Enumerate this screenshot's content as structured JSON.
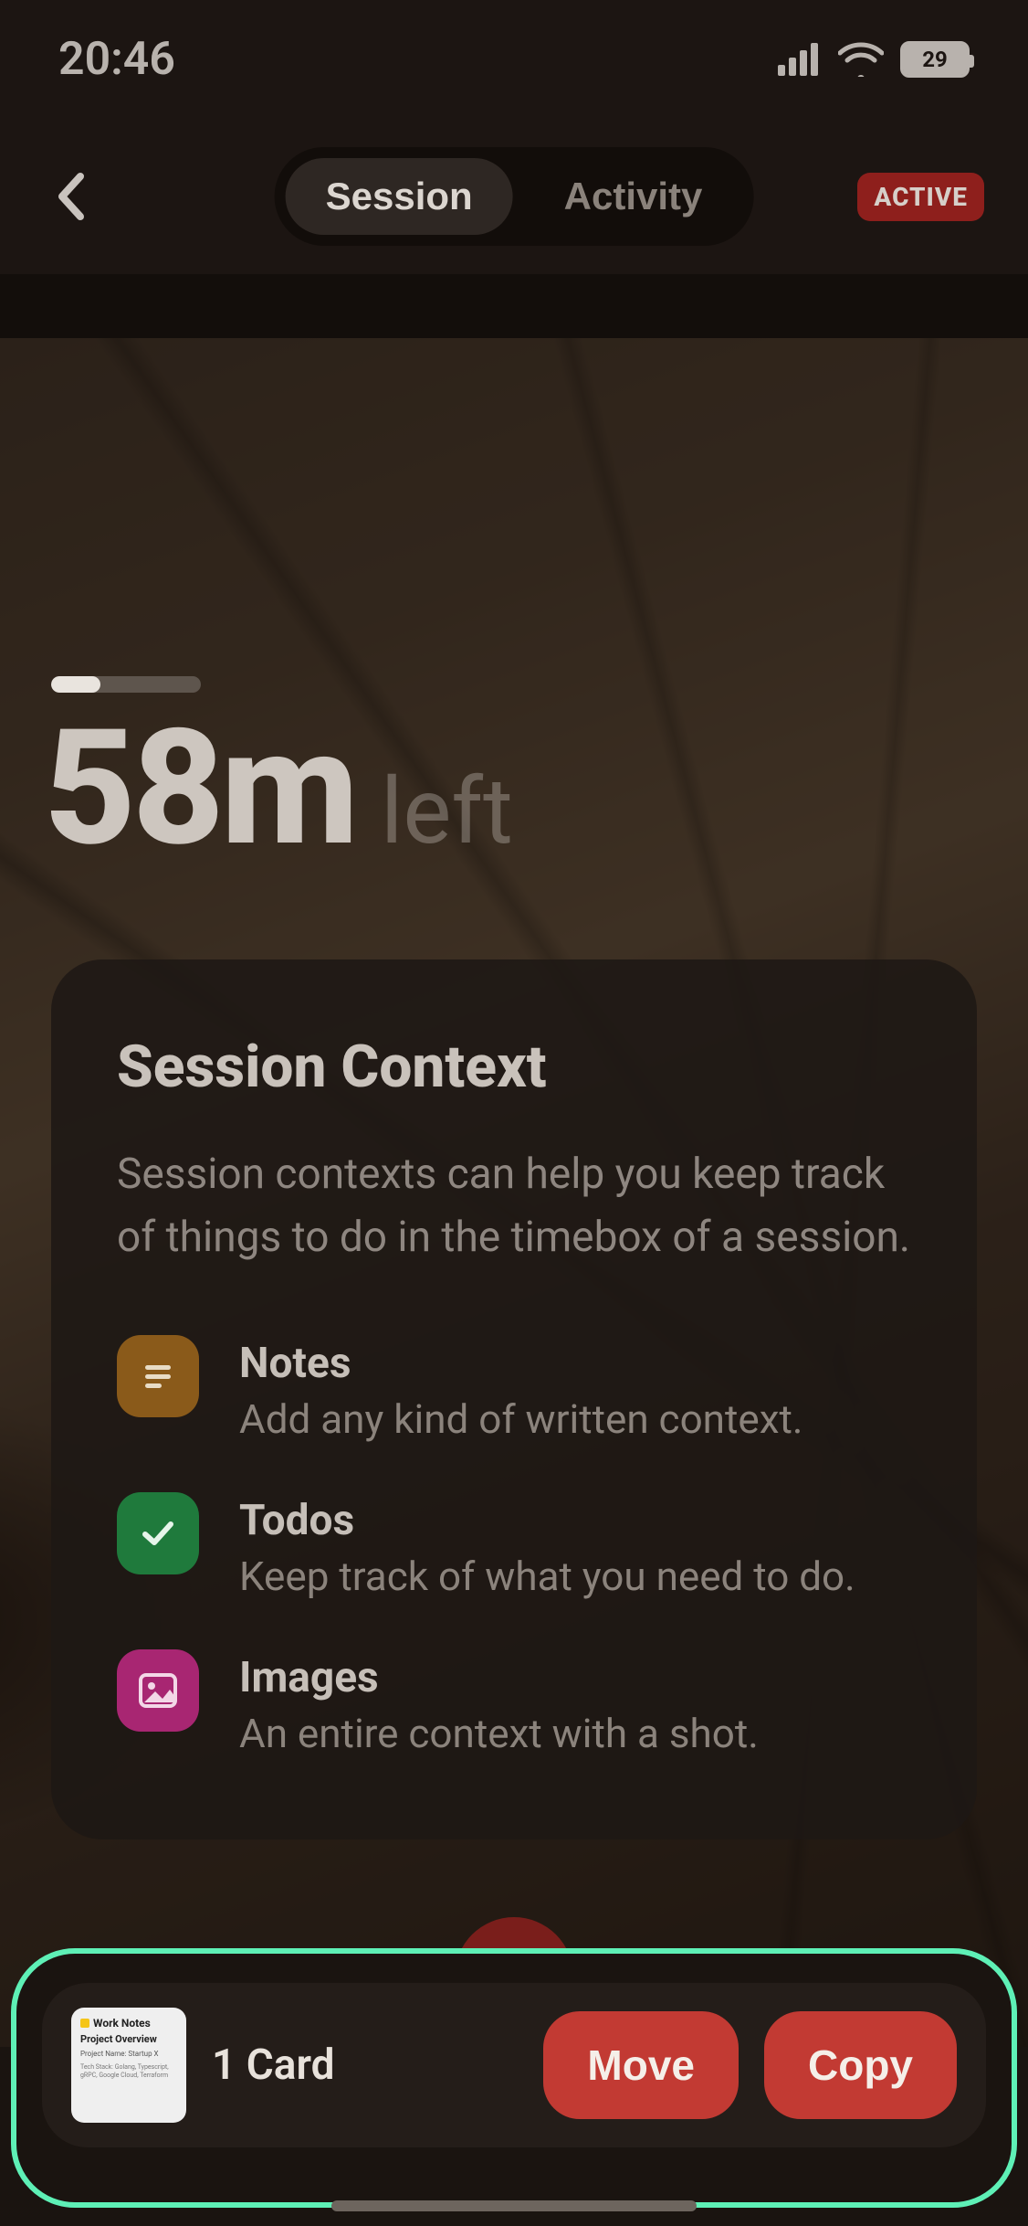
{
  "status_bar": {
    "time": "20:46",
    "battery_percent": "29"
  },
  "header": {
    "tabs": {
      "session": "Session",
      "activity": "Activity"
    },
    "active_badge": "ACTIVE"
  },
  "timer": {
    "value": "58m",
    "label": "left",
    "progress_fraction": 0.33
  },
  "context_card": {
    "title": "Session Context",
    "description": "Session contexts can help you keep track of things to do in the timebox of a session.",
    "features": {
      "notes": {
        "title": "Notes",
        "subtitle": "Add any kind of written context."
      },
      "todos": {
        "title": "Todos",
        "subtitle": "Keep track of what you need to do."
      },
      "images": {
        "title": "Images",
        "subtitle": "An entire context with a shot."
      }
    }
  },
  "bottom_bar": {
    "thumb": {
      "line1": "Work Notes",
      "line2": "Project Overview",
      "line3": "Project Name: Startup X",
      "line4": "Tech Stack: Golang, Typescript, gRPC, Google Cloud, Terraform"
    },
    "count_label": "1 Card",
    "move_label": "Move",
    "copy_label": "Copy"
  },
  "colors": {
    "accent_red": "#c23a33",
    "badge_red": "#8e1f1c",
    "highlight_border": "#5ef0b6",
    "notes_icon": "#8a5a1a",
    "todos_icon": "#1f7a3c",
    "images_icon": "#a82672"
  }
}
